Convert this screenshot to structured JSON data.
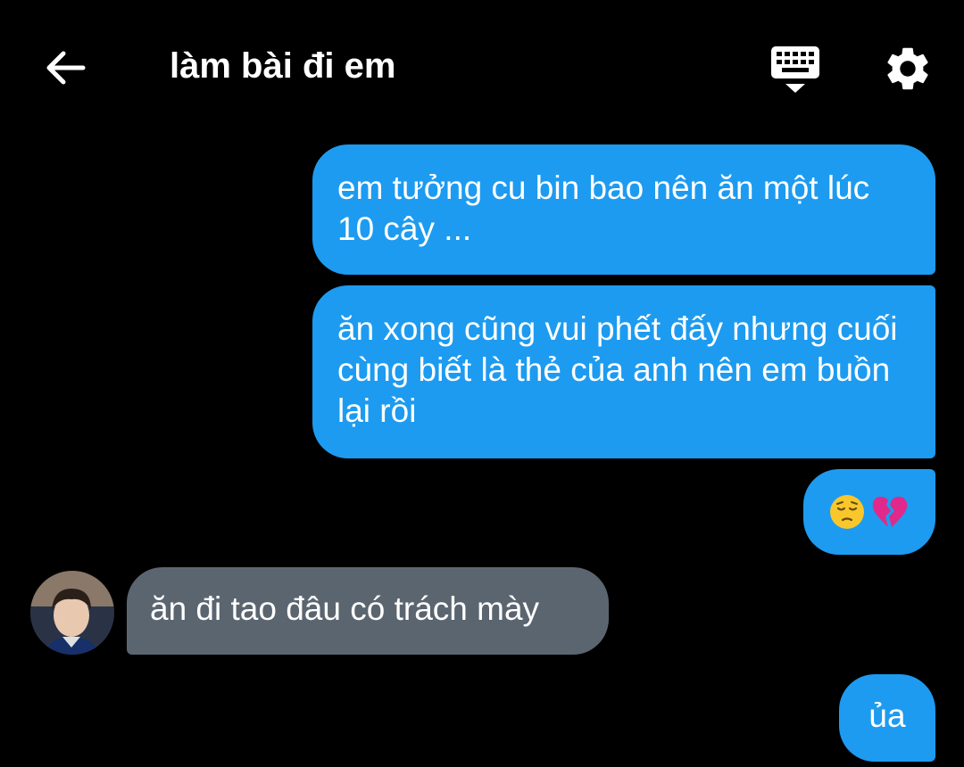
{
  "header": {
    "title": "làm bài đi em",
    "icons": {
      "back": "arrow-left-icon",
      "keyboard": "keyboard-icon",
      "settings": "gear-icon"
    }
  },
  "colors": {
    "background": "#000000",
    "outgoing_bubble": "#1d9bf0",
    "incoming_bubble": "#5b6570",
    "text": "#ffffff"
  },
  "messages": [
    {
      "direction": "outgoing",
      "text": "em tưởng cu bin bao nên ăn một lúc 10 cây ..."
    },
    {
      "direction": "outgoing",
      "text": "ăn xong cũng vui phết đấy nhưng cuối cùng biết là thẻ của anh nên em buồn lại rồi"
    },
    {
      "direction": "outgoing",
      "emojis": [
        "pensive-face-emoji",
        "broken-heart-emoji"
      ]
    },
    {
      "direction": "incoming",
      "text": "ăn đi tao đâu có trách mày"
    },
    {
      "direction": "outgoing",
      "text": "ủa"
    }
  ]
}
